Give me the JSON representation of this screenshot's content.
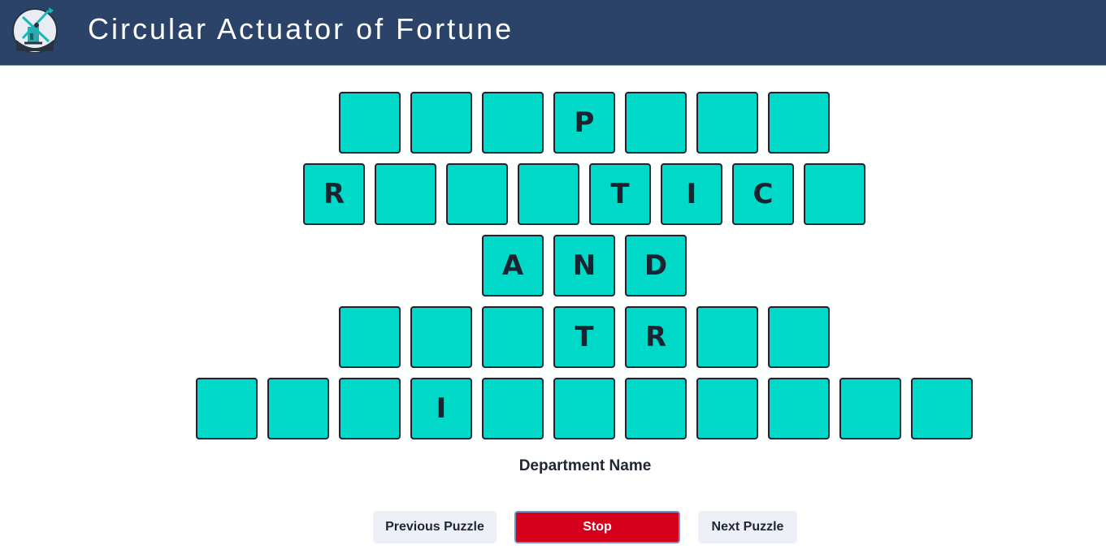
{
  "header": {
    "title": "Circular Actuator of Fortune",
    "logo": "windmill-logo-icon"
  },
  "puzzle": {
    "rows": [
      [
        "",
        "",
        "",
        "P",
        "",
        "",
        ""
      ],
      [
        "R",
        "",
        "",
        "",
        "T",
        "I",
        "C",
        ""
      ],
      [
        "A",
        "N",
        "D"
      ],
      [
        "",
        "",
        "",
        "T",
        "R",
        "",
        ""
      ],
      [
        "",
        "",
        "",
        "I",
        "",
        "",
        "",
        "",
        "",
        "",
        ""
      ]
    ],
    "category": "Department Name"
  },
  "controls": {
    "previous_label": "Previous Puzzle",
    "stop_label": "Stop",
    "next_label": "Next Puzzle"
  },
  "colors": {
    "header_bg": "#2b4368",
    "tile_bg": "#00d9c7",
    "stop_bg": "#d6001c",
    "secondary_bg": "#edf1f7"
  }
}
